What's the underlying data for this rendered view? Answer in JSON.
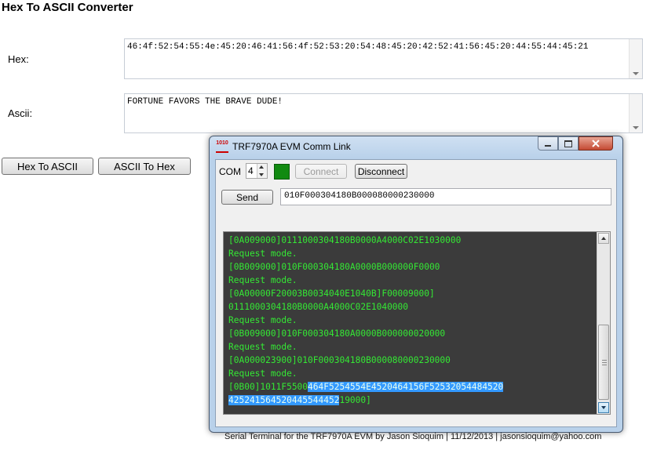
{
  "page": {
    "title": "Hex To ASCII Converter"
  },
  "form": {
    "hex_label": "Hex:",
    "hex_value": "46:4f:52:54:55:4e:45:20:46:41:56:4f:52:53:20:54:48:45:20:42:52:41:56:45:20:44:55:44:45:21",
    "ascii_label": "Ascii:",
    "ascii_value": "FORTUNE FAVORS THE BRAVE DUDE!",
    "hex_to_ascii_label": "Hex To ASCII",
    "ascii_to_hex_label": "ASCII To Hex"
  },
  "dialog": {
    "title": "TRF7970A EVM Comm Link",
    "icon_text": "1010",
    "com_label": "COM",
    "com_value": "4",
    "connect_label": "Connect",
    "disconnect_label": "Disconnect",
    "send_label": "Send",
    "command_value": "010F000304180B000080000230000",
    "terminal_lines": [
      {
        "text": "[0A009000]0111000304180B0000A4000C02E1030000"
      },
      {
        "text": "Request mode."
      },
      {
        "text": "[0B009000]010F000304180A0000B000000F0000"
      },
      {
        "text": "Request mode."
      },
      {
        "text": "[0A00000F20003B0034040E1040B]F00009000]"
      },
      {
        "text": "0111000304180B0000A4000C02E1040000"
      },
      {
        "text": "Request mode."
      },
      {
        "text": "[0B009000]010F000304180A0000B000000020000"
      },
      {
        "text": "Request mode."
      },
      {
        "text": "[0A000023900]010F000304180B000080000230000"
      },
      {
        "text": "Request mode."
      },
      {
        "pre": "[0B00]1011F5500",
        "sel": "464F5254554E4520464156F52532054484520"
      },
      {
        "pre": "",
        "sel": "425241564520445544452",
        "post": "19000]"
      }
    ],
    "footer": "Serial Terminal for the TRF7970A EVM by Jason Sioquim | 11/12/2013 | jasonsioquim@yahoo.com",
    "colors": {
      "terminal_bg": "#3b3b3b",
      "terminal_text": "#34e834",
      "selection": "#3399ff",
      "status_led": "#118a11"
    }
  }
}
